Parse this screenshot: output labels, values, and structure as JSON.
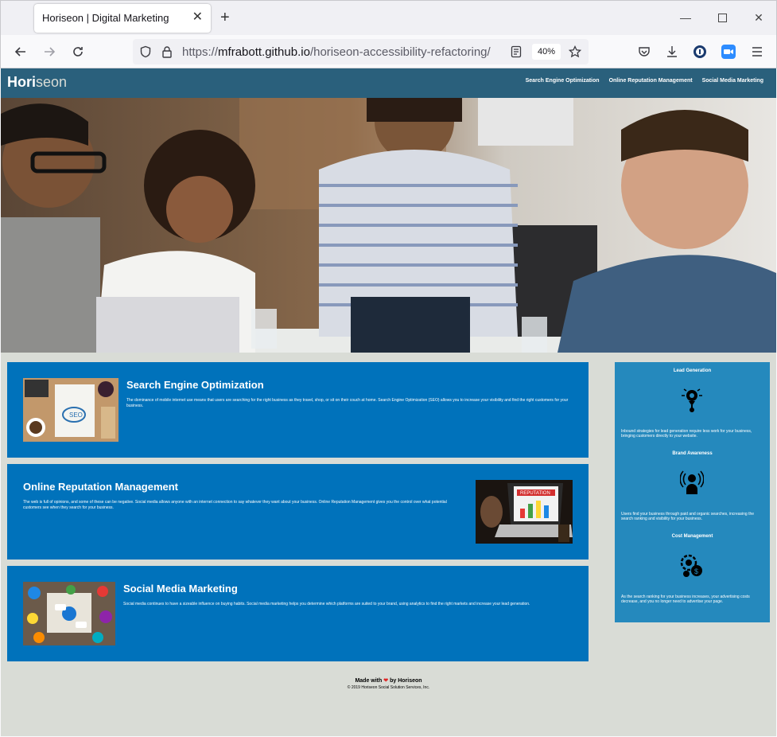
{
  "browser": {
    "tab_title": "Horiseon | Digital Marketing",
    "url_scheme": "https://",
    "url_host": "mfrabott.github.io",
    "url_path": "/horiseon-accessibility-refactoring/",
    "zoom": "40%"
  },
  "site": {
    "logo_main": "Hori",
    "logo_accent": "seon",
    "nav": [
      "Search Engine Optimization",
      "Online Reputation Management",
      "Social Media Marketing"
    ]
  },
  "content": {
    "seo": {
      "title": "Search Engine Optimization",
      "text": "The dominance of mobile internet use means that users are searching for the right business as they travel, shop, or sit on their couch at home. Search Engine Optimization (SEO) allows you to increase your visibility and find the right customers for your business."
    },
    "orm": {
      "title": "Online Reputation Management",
      "text": "The web is full of opinions, and some of these can be negative. Social media allows anyone with an internet connection to say whatever they want about your business. Online Reputation Management gives you the control over what potential customers see when they search for your business."
    },
    "smm": {
      "title": "Social Media Marketing",
      "text": "Social media continues to have a sizeable influence on buying habits. Social media marketing helps you determine which platforms are suited to your brand, using analytics to find the right markets and increase your lead generation."
    }
  },
  "benefits": [
    {
      "title": "Lead Generation",
      "icon": "lead-generation-icon",
      "text": "Inbound strategies for lead generation require less work for your business, bringing customers directly to your website."
    },
    {
      "title": "Brand Awareness",
      "icon": "brand-awareness-icon",
      "text": "Users find your business through paid and organic searches, increasing the search ranking and visibility for your business."
    },
    {
      "title": "Cost Management",
      "icon": "cost-management-icon",
      "text": "As the search ranking for your business increases, your advertising costs decrease, and you no longer need to advertise your page."
    }
  ],
  "footer": {
    "made_with": "Made with",
    "by": "by Horiseon",
    "copyright": "© 2019 Horiseon Social Solution Services, Inc."
  },
  "colors": {
    "header": "#2a607c",
    "content_bg": "#0072bb",
    "benefits_bg": "#2589bd",
    "page_bg": "#d9dcd6"
  }
}
